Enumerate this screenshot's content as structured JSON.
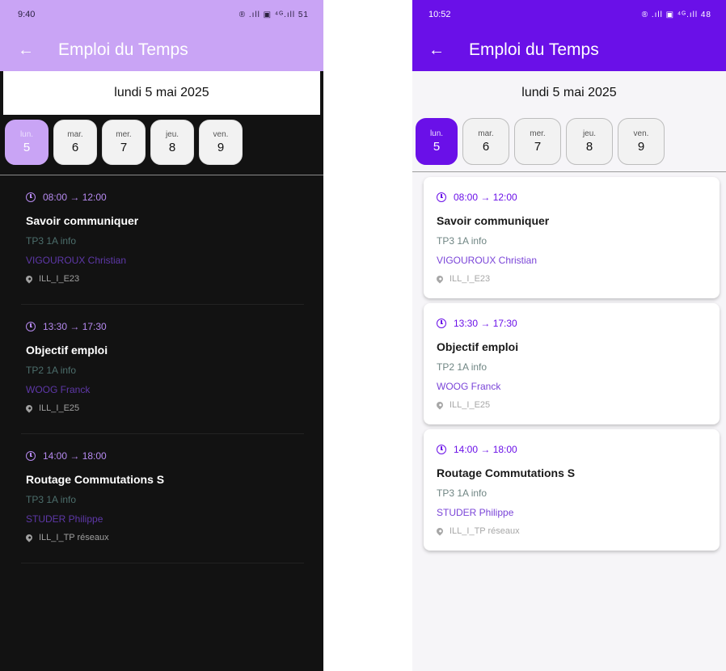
{
  "screens": {
    "dark": {
      "status_bar": {
        "time": "9:40",
        "icons": "® .ıll ▣ ⁴ᴳ.ıll 51"
      },
      "app_bar": {
        "back_icon": "←",
        "title": "Emploi du Temps"
      },
      "date": "lundi 5 mai 2025",
      "days": [
        {
          "abbr": "lun.",
          "num": "5",
          "selected": true
        },
        {
          "abbr": "mar.",
          "num": "6"
        },
        {
          "abbr": "mer.",
          "num": "7"
        },
        {
          "abbr": "jeu.",
          "num": "8"
        },
        {
          "abbr": "ven.",
          "num": "9"
        }
      ],
      "courses": [
        {
          "time": "08:00 → 12:00",
          "title": "Savoir communiquer",
          "group": "TP3 1A info",
          "teacher": "VIGOUROUX Christian",
          "room": "ILL_I_E23"
        },
        {
          "time": "13:30 → 17:30",
          "title": "Objectif emploi",
          "group": "TP2 1A info",
          "teacher": "WOOG Franck",
          "room": "ILL_I_E25"
        },
        {
          "time": "14:00 → 18:00",
          "title": "Routage Commutations S",
          "group": "TP3 1A info",
          "teacher": "STUDER Philippe",
          "room": "ILL_I_TP réseaux"
        }
      ]
    },
    "light": {
      "status_bar": {
        "time": "10:52",
        "icons": "® .ıll ▣ ⁴ᴳ.ıll 48"
      },
      "app_bar": {
        "back_icon": "←",
        "title": "Emploi du Temps"
      },
      "date": "lundi 5 mai 2025",
      "days": [
        {
          "abbr": "lun.",
          "num": "5",
          "selected": true
        },
        {
          "abbr": "mar.",
          "num": "6"
        },
        {
          "abbr": "mer.",
          "num": "7"
        },
        {
          "abbr": "jeu.",
          "num": "8"
        },
        {
          "abbr": "ven.",
          "num": "9"
        }
      ],
      "courses": [
        {
          "time": "08:00 → 12:00",
          "title": "Savoir communiquer",
          "group": "TP3 1A info",
          "teacher": "VIGOUROUX Christian",
          "room": "ILL_I_E23"
        },
        {
          "time": "13:30 → 17:30",
          "title": "Objectif emploi",
          "group": "TP2 1A info",
          "teacher": "WOOG Franck",
          "room": "ILL_I_E25"
        },
        {
          "time": "14:00 → 18:00",
          "title": "Routage Commutations S",
          "group": "TP3 1A info",
          "teacher": "STUDER Philippe",
          "room": "ILL_I_TP réseaux"
        }
      ]
    }
  },
  "colors": {
    "dark_accent": "#c9a4f5",
    "light_accent": "#6a10e8",
    "dark_background": "#121212",
    "light_background": "#f6f5f8"
  }
}
